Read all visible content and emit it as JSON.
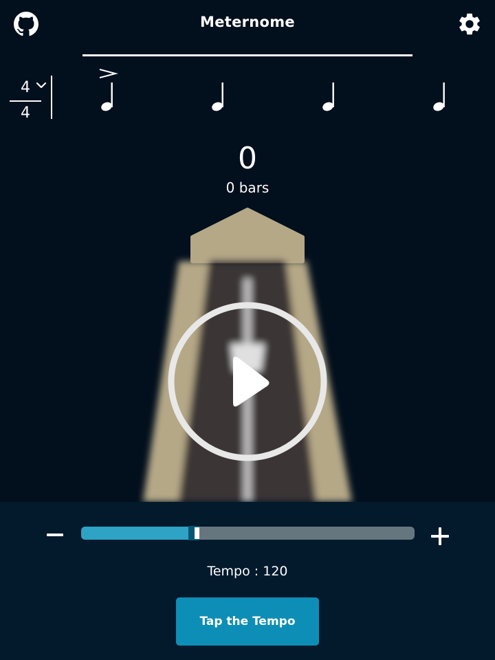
{
  "header": {
    "title": "Meternome",
    "left_icon": "github-icon",
    "right_icon": "gear-icon"
  },
  "time_signature": {
    "numerator": "4",
    "denominator": "4",
    "dropdown_icon": "chevron-down-icon"
  },
  "beats": [
    {
      "icon": "quarter-note-icon",
      "accent": true
    },
    {
      "icon": "quarter-note-icon",
      "accent": false
    },
    {
      "icon": "quarter-note-icon",
      "accent": false
    },
    {
      "icon": "quarter-note-icon",
      "accent": false
    }
  ],
  "counter": {
    "beat_count": "0",
    "bars_label": "0 bars"
  },
  "metronome": {
    "play_icon": "play-icon"
  },
  "controls": {
    "minus_icon": "minus-icon",
    "plus_icon": "plus-icon",
    "slider_value": 0.355,
    "tempo_label": "Tempo : 120",
    "tap_button_label": "Tap the Tempo"
  },
  "colors": {
    "background": "#020f1c",
    "controls_panel": "#021a2c",
    "accent": "#2ea3c4",
    "button": "#0d8eb6",
    "metronome_body": "#b5a887",
    "metronome_face": "#3a3536"
  }
}
